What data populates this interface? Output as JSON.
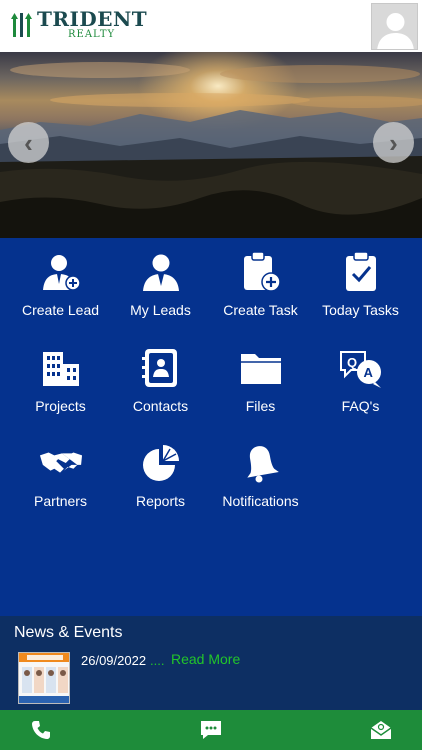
{
  "header": {
    "logo_text": "TRIDENT",
    "logo_subtext": "REALTY",
    "avatar_icon": "user-avatar-icon"
  },
  "banner": {
    "prev_icon": "chevron-left-icon",
    "next_icon": "chevron-right-icon",
    "prev_glyph": "‹",
    "next_glyph": "›"
  },
  "menu": {
    "items": [
      {
        "label": "Create Lead",
        "icon": "add-user-icon"
      },
      {
        "label": "My Leads",
        "icon": "user-icon"
      },
      {
        "label": "Create Task",
        "icon": "clipboard-add-icon"
      },
      {
        "label": "Today Tasks",
        "icon": "clipboard-check-icon"
      },
      {
        "label": "Projects",
        "icon": "buildings-icon"
      },
      {
        "label": "Contacts",
        "icon": "address-book-icon"
      },
      {
        "label": "Files",
        "icon": "folder-icon"
      },
      {
        "label": "FAQ's",
        "icon": "faq-icon"
      },
      {
        "label": "Partners",
        "icon": "handshake-icon"
      },
      {
        "label": "Reports",
        "icon": "pie-chart-icon"
      },
      {
        "label": "Notifications",
        "icon": "bell-icon"
      }
    ]
  },
  "news": {
    "title": "News & Events",
    "items": [
      {
        "date": "26/09/2022",
        "dots": "....",
        "read_more": "Read More",
        "thumb_icon": "news-thumbnail-image"
      }
    ]
  },
  "footer": {
    "items": [
      {
        "icon": "phone-icon"
      },
      {
        "icon": "chat-icon"
      },
      {
        "icon": "mail-icon"
      }
    ]
  },
  "colors": {
    "menu_bg": "#05328e",
    "news_bg": "#0d2f63",
    "footer_bg": "#1e8c3a",
    "accent_green": "#22c52a",
    "logo_teal": "#1b4a4f"
  }
}
